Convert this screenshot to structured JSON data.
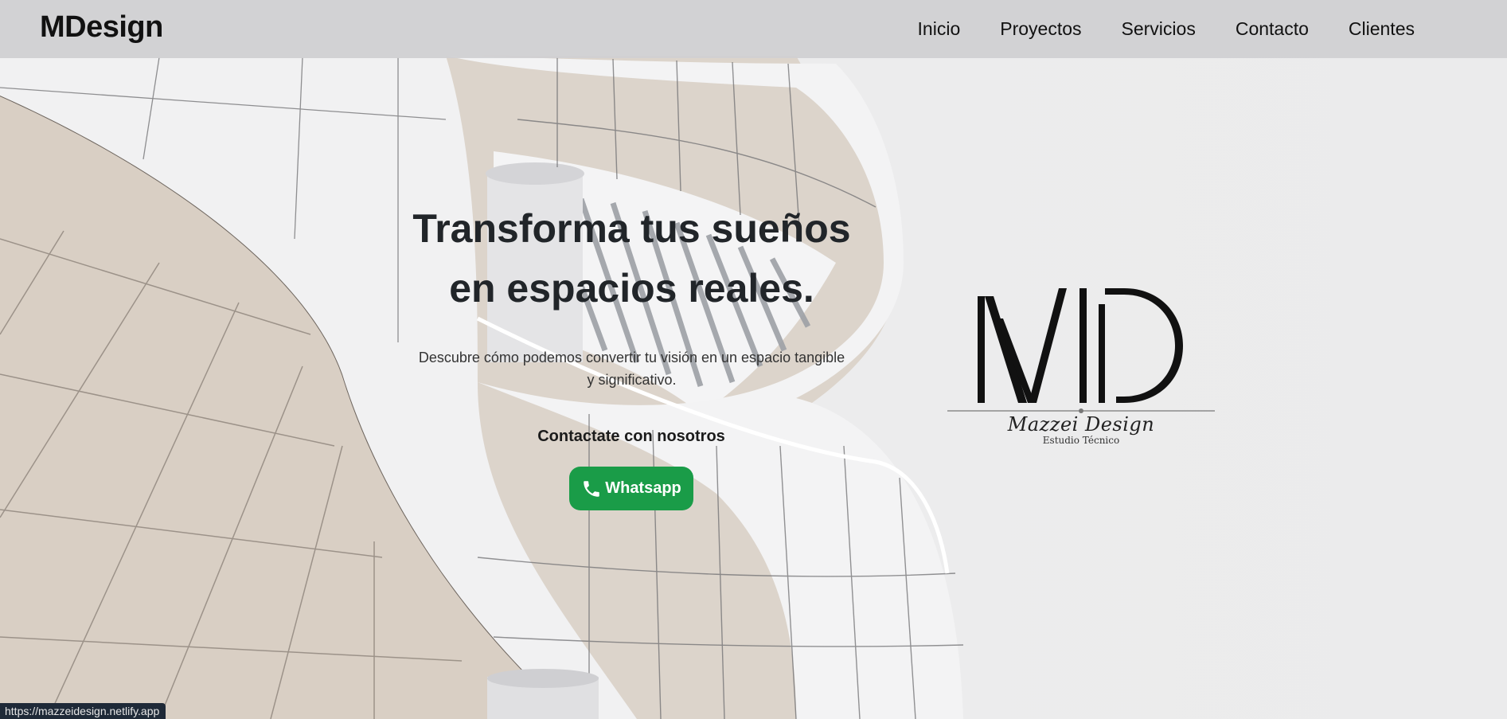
{
  "nav": {
    "brand": "MDesign",
    "links": [
      "Inicio",
      "Proyectos",
      "Servicios",
      "Contacto",
      "Clientes"
    ]
  },
  "hero": {
    "title_line1": "Transforma tus sueños",
    "title_line2": "en espacios reales.",
    "subtitle": "Descubre cómo podemos convertir tu visión en un espacio tangible y significativo.",
    "cta_label": "Contactate con nosotros",
    "whatsapp_label": "Whatsapp"
  },
  "logo": {
    "monogram": "MD",
    "name": "Mazzei Design",
    "tagline": "Estudio Técnico"
  },
  "status_bar": {
    "url": "https://mazzeidesign.netlify.app"
  },
  "colors": {
    "accent_green": "#1a9c48",
    "text_dark": "#212529",
    "navbar_bg": "#d0d0d2"
  },
  "icons": {
    "whatsapp": "phone-icon"
  }
}
